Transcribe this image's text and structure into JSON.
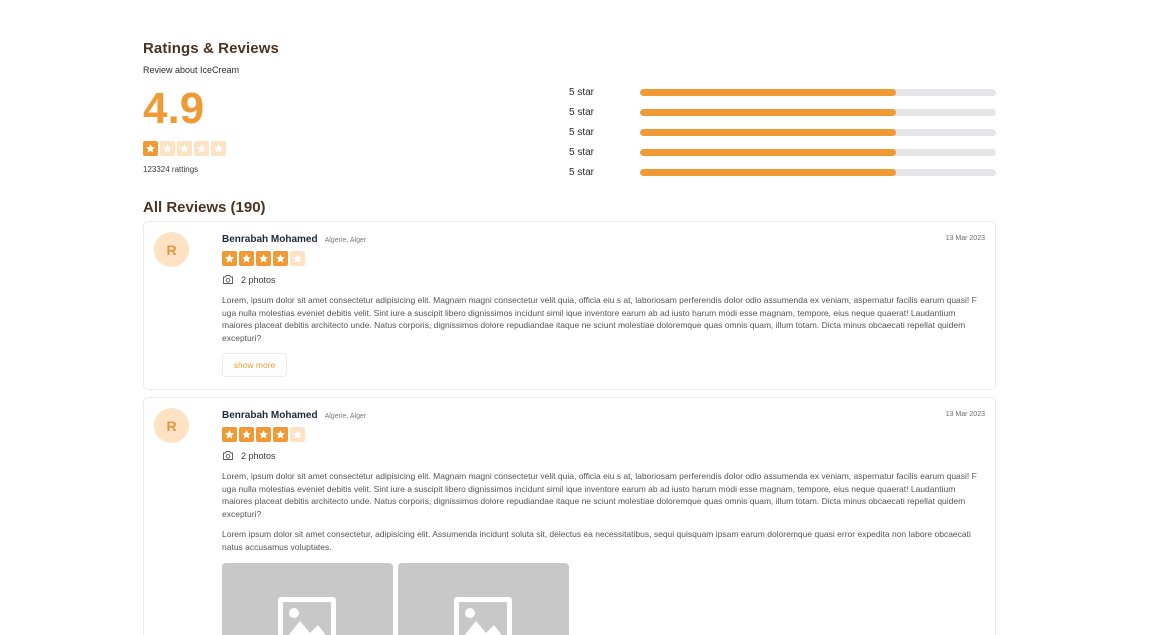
{
  "header": {
    "title": "Ratings & Reviews",
    "subtitle": "Review about IceCream"
  },
  "summary": {
    "average": "4.9",
    "stars_filled": 1,
    "stars_total": 5,
    "count": "123324 rattings"
  },
  "distribution": [
    {
      "label": "5 star",
      "fill": 0.72
    },
    {
      "label": "5 star",
      "fill": 0.72
    },
    {
      "label": "5 star",
      "fill": 0.72
    },
    {
      "label": "5 star",
      "fill": 0.72
    },
    {
      "label": "5 star",
      "fill": 0.72
    }
  ],
  "all_reviews_title": "All Reviews (190)",
  "reviews": [
    {
      "initial": "R",
      "name": "Benrabah Mohamed",
      "location": "Algerie, Alger",
      "date": "13 Mar 2023",
      "stars": 4,
      "photos": "2 photos",
      "text": "Lorem, ipsum dolor sit amet consectetur adipisicing elit. Magnam magni consectetur velit quia, officia eiu s at, laboriosam perferendis dolor odio assumenda ex veniam, aspernatur facilis earum quasi! F uga nulla molestias eveniet debitis velit. Sint iure a suscipit libero dignissimos incidunt simil ique inventore earum ab ad iusto harum modi esse magnam, tempore, eius neque quaerat! Laudantium maiores placeat debitis architecto unde. Natus corporis, dignissimos dolore repudiandae itaque ne sciunt molestiae doloremque quas omnis quam, illum totam. Dicta minus obcaecati repellat quidem excepturi?",
      "show_more": "show more"
    },
    {
      "initial": "R",
      "name": "Benrabah Mohamed",
      "location": "Algerie, Alger",
      "date": "13 Mar 2023",
      "stars": 4,
      "photos": "2 photos",
      "text": "Lorem, ipsum dolor sit amet consectetur adipisicing elit. Magnam magni consectetur velit quia, officia eiu s at, laboriosam perferendis dolor odio assumenda ex veniam, aspernatur facilis earum quasi! F uga nulla molestias eveniet debitis velit. Sint iure a suscipit libero dignissimos incidunt simil ique inventore earum ab ad iusto harum modi esse magnam, tempore, eius neque quaerat! Laudantium maiores placeat debitis architecto unde. Natus corporis, dignissimos dolore repudiandae itaque ne sciunt molestiae doloremque quas omnis quam, illum totam. Dicta minus obcaecati repellat quidem excepturi?",
      "text2": "Lorem ipsum dolor sit amet consectetur, adipisicing elit. Assumenda incidunt soluta sit, delectus ea necessitatibus, sequi quisquam ipsam earum doloremque quasi error expedita non labore obcaecati natus accusamus voluptates."
    }
  ],
  "colors": {
    "accent": "#f09a36",
    "accent_light": "#fde3c3",
    "track": "#e6e6e8",
    "heading": "#4a3426"
  },
  "icons": {
    "star": "star-icon",
    "camera": "camera-icon",
    "image_placeholder": "image-placeholder-icon"
  }
}
